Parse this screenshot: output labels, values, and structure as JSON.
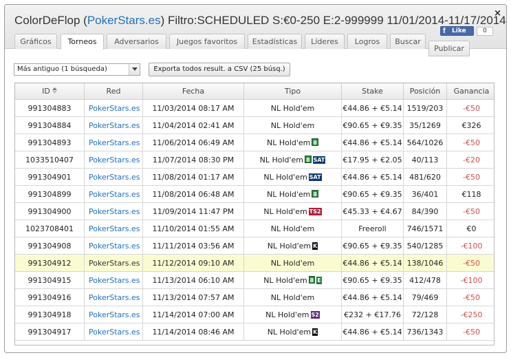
{
  "window": {
    "title_prefix": "ColorDeFlop (",
    "title_site": "PokerStars.es",
    "title_suffix": ") Filtro:SCHEDULED S:€0-250 E:2-999999 11/01/2014-11/17/2014",
    "close": "×"
  },
  "facebook": {
    "like_label": "Like",
    "count": "0"
  },
  "tabs": [
    {
      "label": "Gráficos"
    },
    {
      "label": "Torneos"
    },
    {
      "label": "Adversarios"
    },
    {
      "label": "Juegos favoritos"
    },
    {
      "label": "Estadísticas"
    },
    {
      "label": "Líderes"
    },
    {
      "label": "Logros"
    },
    {
      "label": "Buscar"
    },
    {
      "label": "Publicar"
    }
  ],
  "active_tab": "Torneos",
  "toolbar": {
    "sort_select_value": "Más antiguo (1 búsqueda)",
    "export_label": "Exporta todos result. a CSV (25 búsq.)"
  },
  "table": {
    "columns": [
      "ID",
      "Red",
      "Fecha",
      "Tipo",
      "Stake",
      "Posición",
      "Ganancia"
    ],
    "rows": [
      {
        "id": "991304883",
        "red": "PokerStars.es",
        "fecha": "11/03/2014 08:17 AM",
        "tipo": "NL Hold'em",
        "badges": [],
        "stake": "€44.86 + €5.14",
        "pos": "1519/203",
        "gan": "-€50",
        "neg": true
      },
      {
        "id": "991304884",
        "red": "PokerStars.es",
        "fecha": "11/04/2014 02:41 AM",
        "tipo": "NL Hold'em",
        "badges": [],
        "stake": "€90.65 + €9.35",
        "pos": "35/1269",
        "gan": "€326",
        "neg": false
      },
      {
        "id": "991304893",
        "red": "PokerStars.es",
        "fecha": "11/06/2014 06:49 AM",
        "tipo": "NL Hold'em",
        "badges": [
          "8"
        ],
        "stake": "€44.86 + €5.14",
        "pos": "564/1026",
        "gan": "-€50",
        "neg": true
      },
      {
        "id": "1033510407",
        "red": "PokerStars.es",
        "fecha": "11/07/2014 08:30 PM",
        "tipo": "NL Hold'em",
        "badges": [
          "8",
          "SAT"
        ],
        "stake": "€17.95 + €2.05",
        "pos": "40/113",
        "gan": "-€20",
        "neg": true
      },
      {
        "id": "991304901",
        "red": "PokerStars.es",
        "fecha": "11/08/2014 01:17 AM",
        "tipo": "NL Hold'em",
        "badges": [
          "SAT"
        ],
        "stake": "€44.86 + €5.14",
        "pos": "481/620",
        "gan": "-€50",
        "neg": true
      },
      {
        "id": "991304899",
        "red": "PokerStars.es",
        "fecha": "11/08/2014 06:48 AM",
        "tipo": "NL Hold'em",
        "badges": [
          "8"
        ],
        "stake": "€90.65 + €9.35",
        "pos": "36/401",
        "gan": "€118",
        "neg": false
      },
      {
        "id": "991304900",
        "red": "PokerStars.es",
        "fecha": "11/09/2014 11:47 PM",
        "tipo": "NL Hold'em",
        "badges": [
          "TS2"
        ],
        "stake": "€45.33 + €4.67",
        "pos": "84/390",
        "gan": "-€50",
        "neg": true
      },
      {
        "id": "1023708401",
        "red": "PokerStars.es",
        "fecha": "11/10/2014 01:55 AM",
        "tipo": "NL Hold'em",
        "badges": [],
        "stake": "Freeroll",
        "pos": "746/1571",
        "gan": "€0",
        "neg": false
      },
      {
        "id": "991304908",
        "red": "PokerStars.es",
        "fecha": "11/11/2014 03:56 AM",
        "tipo": "NL Hold'em",
        "badges": [
          "K"
        ],
        "stake": "€90.65 + €9.35",
        "pos": "540/1285",
        "gan": "-€100",
        "neg": true
      },
      {
        "id": "991304912",
        "red": "PokerStars.es",
        "fecha": "11/12/2014 09:10 AM",
        "tipo": "NL Hold'em",
        "badges": [],
        "stake": "€44.86 + €5.14",
        "pos": "138/1046",
        "gan": "-€50",
        "neg": true,
        "highlight": true
      },
      {
        "id": "991304915",
        "red": "PokerStars.es",
        "fecha": "11/13/2014 06:10 AM",
        "tipo": "NL Hold'em",
        "badges": [
          "8",
          "E"
        ],
        "stake": "€90.65 + €9.35",
        "pos": "412/478",
        "gan": "-€100",
        "neg": true
      },
      {
        "id": "991304916",
        "red": "PokerStars.es",
        "fecha": "11/13/2014 07:57 AM",
        "tipo": "NL Hold'em",
        "badges": [],
        "stake": "€44.86 + €5.14",
        "pos": "79/469",
        "gan": "-€50",
        "neg": true
      },
      {
        "id": "991304918",
        "red": "PokerStars.es",
        "fecha": "11/14/2014 07:00 AM",
        "tipo": "NL Hold'em",
        "badges": [
          "S2"
        ],
        "stake": "€232 + €17.76",
        "pos": "72/128",
        "gan": "-€250",
        "neg": true
      },
      {
        "id": "991304917",
        "red": "PokerStars.es",
        "fecha": "11/14/2014 08:46 AM",
        "tipo": "NL Hold'em",
        "badges": [
          "K"
        ],
        "stake": "€44.86 + €5.14",
        "pos": "736/1343",
        "gan": "-€50",
        "neg": true
      }
    ]
  },
  "colors": {
    "link": "#1f6fbf",
    "negative": "#d24d4d",
    "highlight_row": "#fbfbd2"
  }
}
